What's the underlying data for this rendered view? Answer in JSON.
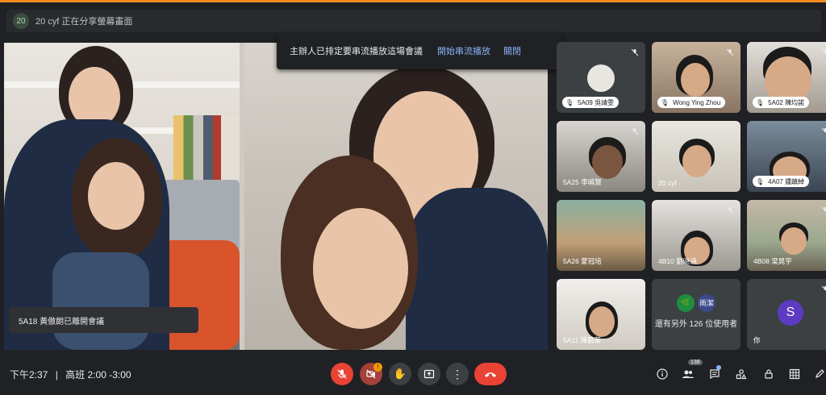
{
  "presenting": {
    "badge": "20",
    "text": "20 cyf 正在分享螢幕畫面"
  },
  "notification": {
    "message": "主辦人已排定要串流播放這場會議",
    "start_stream": "開始串流播放",
    "close": "關閉"
  },
  "left_toast": "5A18 黃傲朗已離開會議",
  "tiles": [
    {
      "name": "5A09 吳靖雯",
      "style": "pill"
    },
    {
      "name": "Wong Ying Zhou",
      "style": "pill"
    },
    {
      "name": "5A02 陳均諾",
      "style": "pill"
    },
    {
      "name": "5A25 李曉賢",
      "style": "plain"
    },
    {
      "name": "20 cyf",
      "style": "plain"
    },
    {
      "name": "4A07 鍾㒹綽",
      "style": "pill"
    },
    {
      "name": "5A26 蒙冠培",
      "style": "plain"
    },
    {
      "name": "4B10 劉晓涵",
      "style": "plain"
    },
    {
      "name": "4B08 梁晁宇",
      "style": "plain"
    },
    {
      "name": "5A11 陳碧華",
      "style": "plain"
    },
    {
      "name": "還有另外 126 位使用者",
      "style": "plain"
    },
    {
      "name": "你",
      "style": "plain"
    }
  ],
  "more_users": {
    "avatar2": "雨潔"
  },
  "self_avatar_letter": "S",
  "bottom": {
    "time": "下午2:37",
    "separator": "|",
    "meeting_code": "高班 2:00 -3:00",
    "participants_count": "138",
    "camera_warning": "!"
  },
  "colors": {
    "mic_off_red": "#ea4335",
    "camera_off": "#a3413a",
    "accent_blue": "#8ab4f8",
    "self_avatar": "#5c3bc2"
  },
  "icons": {
    "mic": "mic-off-icon",
    "camera": "camera-off-icon",
    "hand": "raise-hand-icon",
    "present": "present-icon",
    "more": "more-options-icon",
    "hangup": "hang-up-icon",
    "info": "info-icon",
    "people": "people-icon",
    "chat": "chat-icon",
    "activities": "activities-icon",
    "lock": "host-controls-icon",
    "layout": "layout-icon",
    "pen": "whiteboard-icon"
  }
}
